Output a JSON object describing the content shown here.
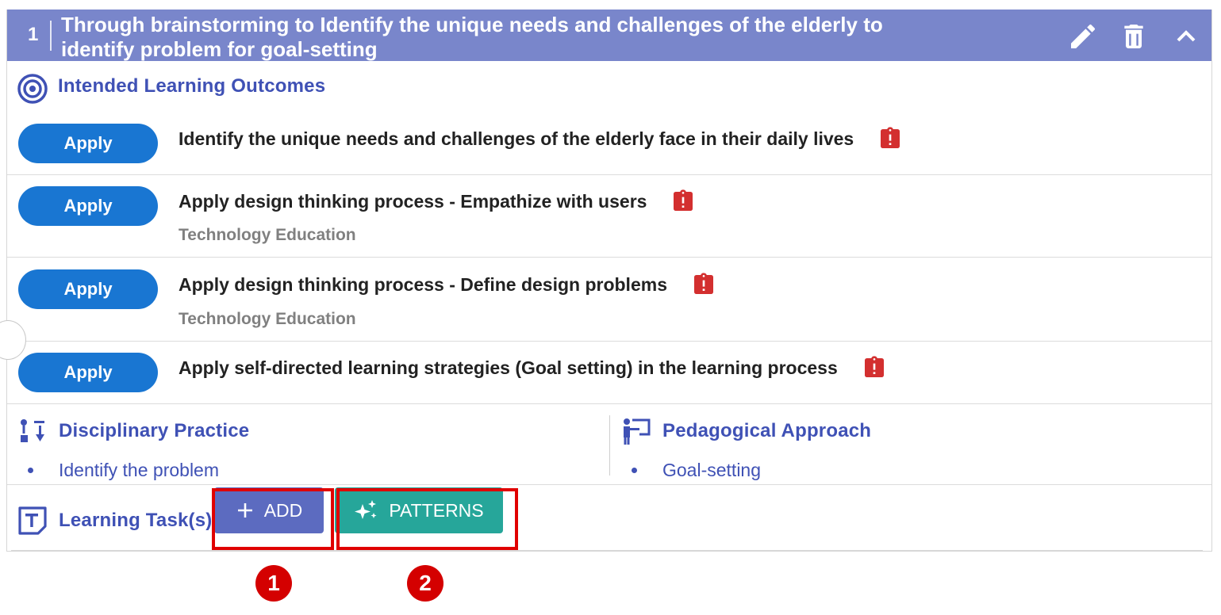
{
  "header": {
    "step_number": "1",
    "title": "Through brainstorming to Identify the unique needs and challenges of the elderly to identify problem for goal-setting",
    "icons": [
      "edit-icon",
      "delete-icon",
      "collapse-icon"
    ]
  },
  "ilo": {
    "title": "Intended Learning Outcomes",
    "icon": "target-icon",
    "items": [
      {
        "button": "Apply",
        "text": "Identify the unique needs and challenges of the elderly face in their daily lives",
        "subject": ""
      },
      {
        "button": "Apply",
        "text": "Apply design thinking process - Empathize with users",
        "subject": "Technology Education"
      },
      {
        "button": "Apply",
        "text": "Apply design thinking process - Define design problems",
        "subject": "Technology Education"
      },
      {
        "button": "Apply",
        "text": "Apply self-directed learning strategies (Goal setting) in the learning process",
        "subject": ""
      }
    ]
  },
  "disciplinary": {
    "title": "Disciplinary Practice",
    "items": [
      "Identify the problem"
    ]
  },
  "pedagogical": {
    "title": "Pedagogical Approach",
    "items": [
      "Goal-setting"
    ]
  },
  "tasks": {
    "title": "Learning Task(s)",
    "add_label": "ADD",
    "patterns_label": "PATTERNS"
  },
  "markers": [
    "1",
    "2"
  ],
  "colors": {
    "header_bg": "#7986cb",
    "accent": "#3f51b5",
    "apply_button": "#1976d2",
    "add_button": "#5c6bc0",
    "patterns_button": "#26a69a",
    "warning_icon": "#d32f2f",
    "highlight": "#e00000"
  }
}
